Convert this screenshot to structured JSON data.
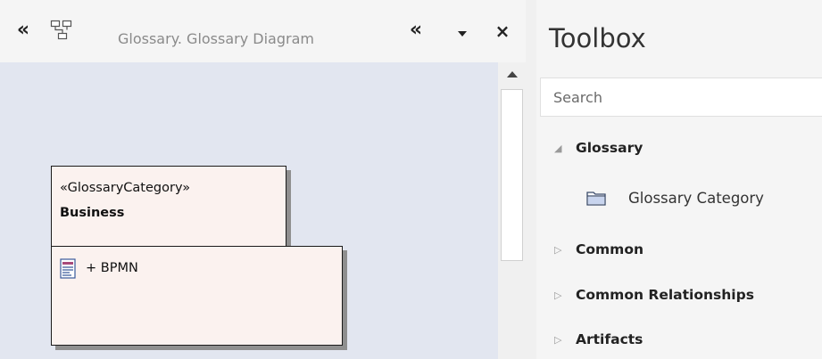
{
  "diagram_pane": {
    "tab_title": "Glossary.  Glossary Diagram",
    "elements": {
      "category": {
        "stereotype": "«GlossaryCategory»",
        "name": "Business"
      },
      "term": {
        "label": "+ BPMN"
      }
    }
  },
  "toolbox": {
    "title": "Toolbox",
    "search": {
      "placeholder": "Search",
      "value": ""
    },
    "groups": [
      {
        "label": "Glossary",
        "expanded": true,
        "items": [
          {
            "label": "Glossary Category",
            "icon": "folder-icon"
          }
        ]
      },
      {
        "label": "Common",
        "expanded": false
      },
      {
        "label": "Common Relationships",
        "expanded": false
      },
      {
        "label": "Artifacts",
        "expanded": false
      }
    ]
  },
  "colors": {
    "canvas": "#e2e6f0",
    "element_fill": "#fbf2ef",
    "element_border": "#1a1a1a",
    "element_shadow": "#8f8f8f",
    "pane_bg": "#f5f5f5"
  }
}
